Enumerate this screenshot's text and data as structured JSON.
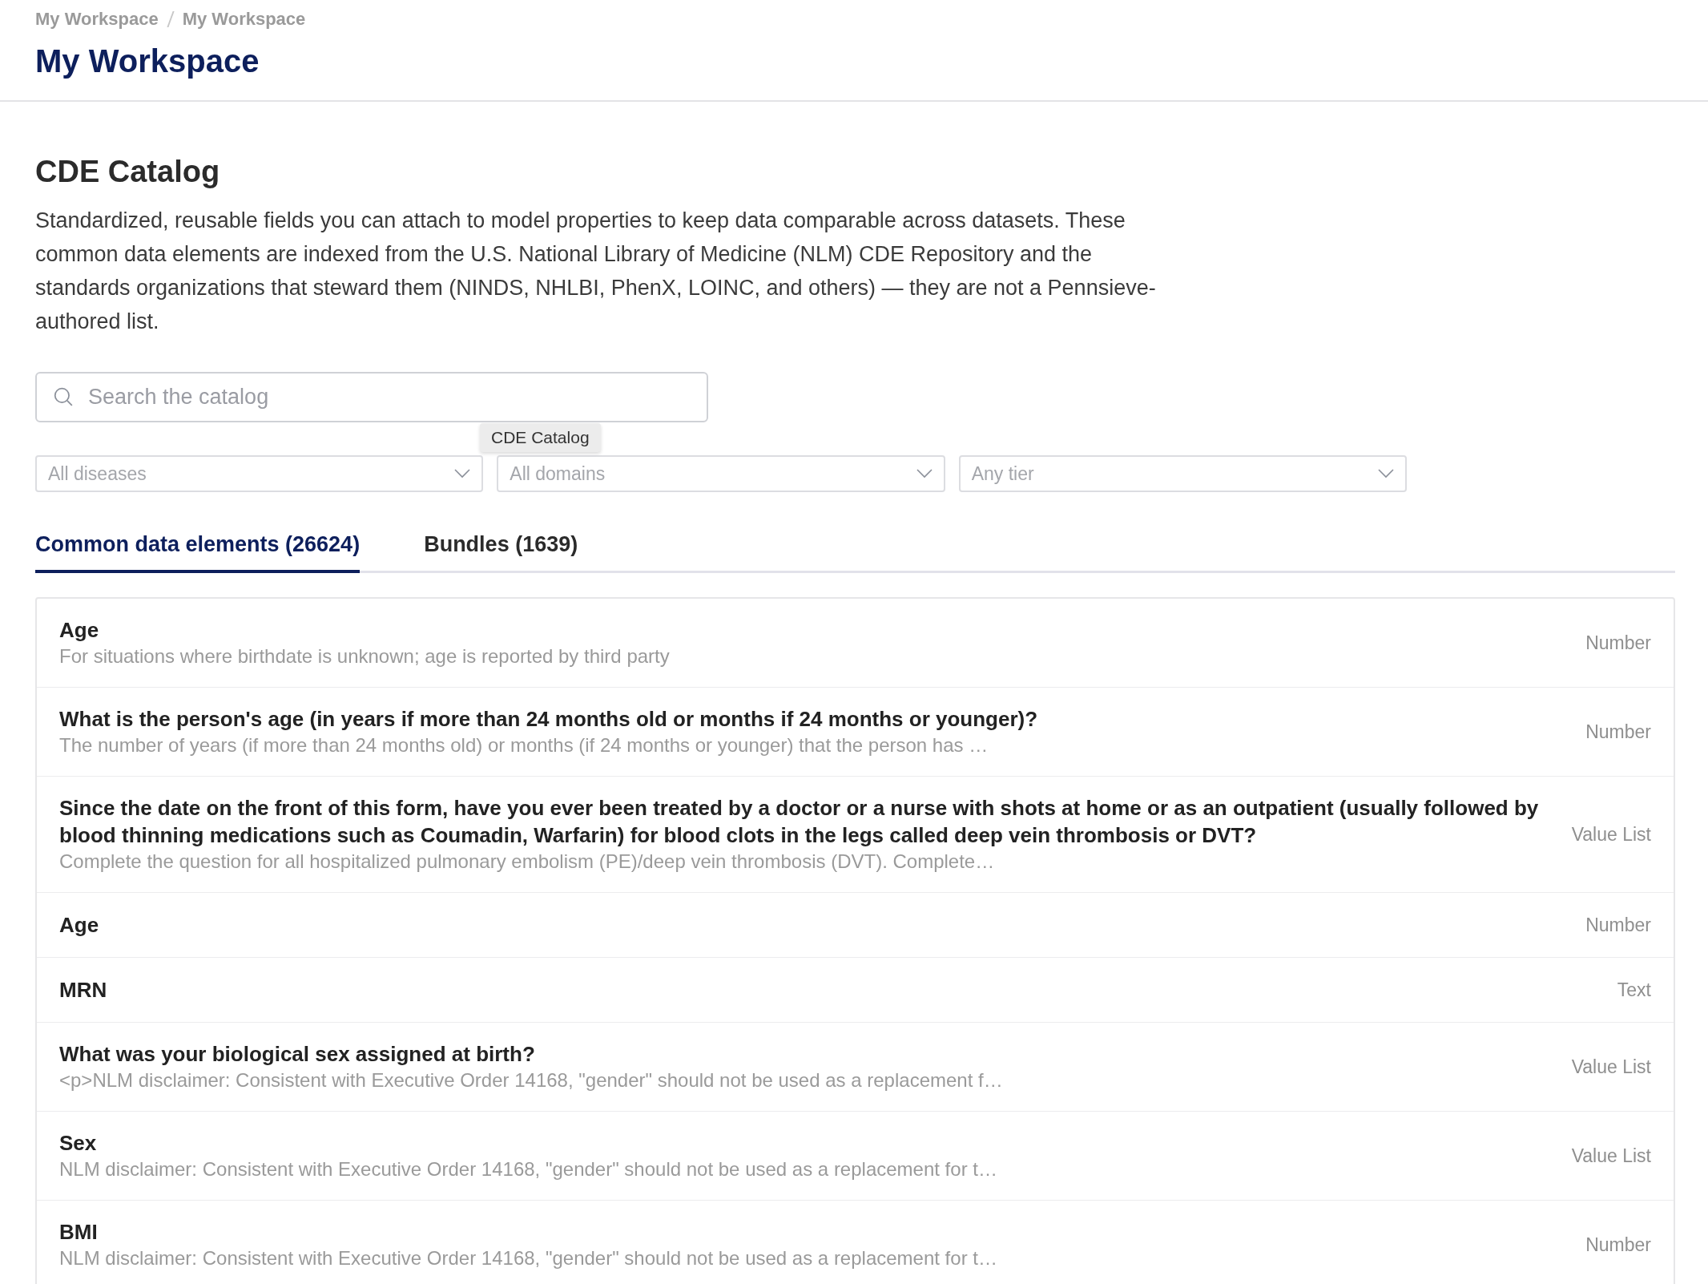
{
  "breadcrumb": [
    "My Workspace",
    "My Workspace"
  ],
  "page_title": "My Workspace",
  "section": {
    "title": "CDE Catalog",
    "description": "Standardized, reusable fields you can attach to model properties to keep data comparable across datasets. These common data elements are indexed from the U.S. National Library of Medicine (NLM) CDE Repository and the standards organizations that steward them (NINDS, NHLBI, PhenX, LOINC, and others) — they are not a Pennsieve-authored list."
  },
  "search": {
    "placeholder": "Search the catalog"
  },
  "tooltip": "CDE Catalog",
  "filters": [
    {
      "placeholder": "All diseases"
    },
    {
      "placeholder": "All domains"
    },
    {
      "placeholder": "Any tier"
    }
  ],
  "tabs": [
    {
      "label": "Common data elements (26624)",
      "selected": true
    },
    {
      "label": "Bundles (1639)",
      "selected": false
    }
  ],
  "elements": [
    {
      "title": "Age",
      "description": "For situations where birthdate is unknown; age is reported by third party",
      "type": "Number"
    },
    {
      "title": "What is the person's age (in years if more than 24 months old or months if 24 months or younger)?",
      "description": "The number of years (if more than 24 months old) or months (if 24 months or younger) that the person has …",
      "type": "Number"
    },
    {
      "title": "Since the date on the front of this form, have you ever been treated by a doctor or a nurse with shots at home or as an outpatient (usually followed by blood thinning medications such as Coumadin, Warfarin) for blood clots in the legs called deep vein thrombosis or DVT?",
      "description": "Complete the question for all hospitalized pulmonary embolism (PE)/deep vein thrombosis (DVT). Complete…",
      "type": "Value List"
    },
    {
      "title": "Age",
      "type": "Number"
    },
    {
      "title": "MRN",
      "type": "Text"
    },
    {
      "title": "What was your biological sex assigned at birth?",
      "description": "<p>NLM disclaimer: Consistent with Executive Order 14168, \"gender\" should not be used as a replacement f…",
      "type": "Value List"
    },
    {
      "title": "Sex",
      "description": "NLM disclaimer: Consistent with Executive Order 14168, \"gender\" should not be used as a replacement for t…",
      "type": "Value List"
    },
    {
      "title": "BMI",
      "description": "NLM disclaimer: Consistent with Executive Order 14168, \"gender\" should not be used as a replacement for t…",
      "type": "Number"
    }
  ]
}
